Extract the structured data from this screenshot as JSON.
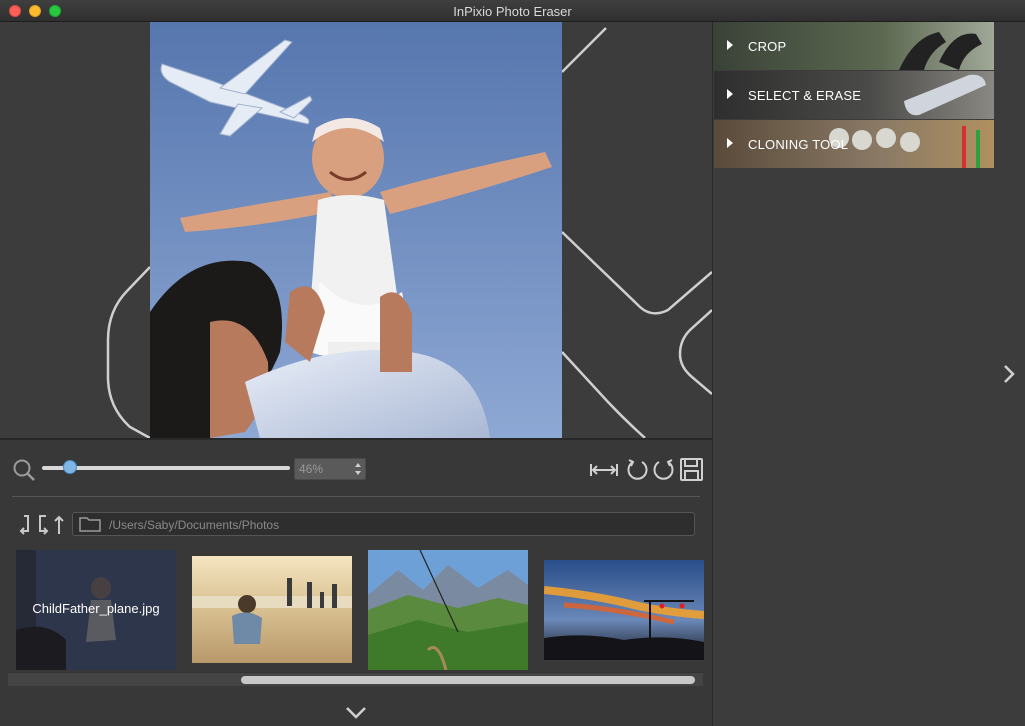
{
  "window": {
    "title": "InPixio Photo Eraser"
  },
  "tools": {
    "items": [
      {
        "label": "CROP"
      },
      {
        "label": "SELECT & ERASE"
      },
      {
        "label": "CLONING TOOL"
      }
    ]
  },
  "zoom": {
    "value": "46%",
    "slider_fraction": 0.12
  },
  "browser": {
    "path": "/Users/Saby/Documents/Photos",
    "thumbnails": [
      {
        "caption": "ChildFather_plane.jpg",
        "selected": true
      },
      {
        "caption": ""
      },
      {
        "caption": ""
      },
      {
        "caption": ""
      }
    ]
  },
  "colors": {
    "accent": "#7fb6e6",
    "background": "#3c3c3c"
  },
  "icons": [
    "zoom-icon",
    "fit-to-screen-icon",
    "rotate-left-icon",
    "rotate-right-icon",
    "save-icon",
    "back-icon",
    "forward-icon",
    "up-icon",
    "folder-icon",
    "chevron-right-icon",
    "chevron-down-icon"
  ]
}
